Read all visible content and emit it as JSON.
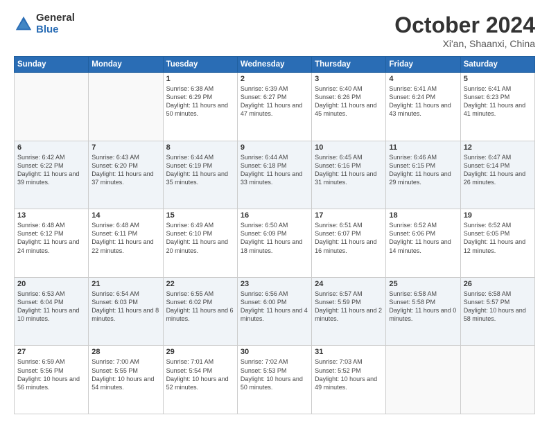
{
  "logo": {
    "general": "General",
    "blue": "Blue"
  },
  "title": {
    "month_year": "October 2024",
    "location": "Xi'an, Shaanxi, China"
  },
  "headers": [
    "Sunday",
    "Monday",
    "Tuesday",
    "Wednesday",
    "Thursday",
    "Friday",
    "Saturday"
  ],
  "weeks": [
    [
      {
        "day": "",
        "sunrise": "",
        "sunset": "",
        "daylight": ""
      },
      {
        "day": "",
        "sunrise": "",
        "sunset": "",
        "daylight": ""
      },
      {
        "day": "1",
        "sunrise": "Sunrise: 6:38 AM",
        "sunset": "Sunset: 6:29 PM",
        "daylight": "Daylight: 11 hours and 50 minutes."
      },
      {
        "day": "2",
        "sunrise": "Sunrise: 6:39 AM",
        "sunset": "Sunset: 6:27 PM",
        "daylight": "Daylight: 11 hours and 47 minutes."
      },
      {
        "day": "3",
        "sunrise": "Sunrise: 6:40 AM",
        "sunset": "Sunset: 6:26 PM",
        "daylight": "Daylight: 11 hours and 45 minutes."
      },
      {
        "day": "4",
        "sunrise": "Sunrise: 6:41 AM",
        "sunset": "Sunset: 6:24 PM",
        "daylight": "Daylight: 11 hours and 43 minutes."
      },
      {
        "day": "5",
        "sunrise": "Sunrise: 6:41 AM",
        "sunset": "Sunset: 6:23 PM",
        "daylight": "Daylight: 11 hours and 41 minutes."
      }
    ],
    [
      {
        "day": "6",
        "sunrise": "Sunrise: 6:42 AM",
        "sunset": "Sunset: 6:22 PM",
        "daylight": "Daylight: 11 hours and 39 minutes."
      },
      {
        "day": "7",
        "sunrise": "Sunrise: 6:43 AM",
        "sunset": "Sunset: 6:20 PM",
        "daylight": "Daylight: 11 hours and 37 minutes."
      },
      {
        "day": "8",
        "sunrise": "Sunrise: 6:44 AM",
        "sunset": "Sunset: 6:19 PM",
        "daylight": "Daylight: 11 hours and 35 minutes."
      },
      {
        "day": "9",
        "sunrise": "Sunrise: 6:44 AM",
        "sunset": "Sunset: 6:18 PM",
        "daylight": "Daylight: 11 hours and 33 minutes."
      },
      {
        "day": "10",
        "sunrise": "Sunrise: 6:45 AM",
        "sunset": "Sunset: 6:16 PM",
        "daylight": "Daylight: 11 hours and 31 minutes."
      },
      {
        "day": "11",
        "sunrise": "Sunrise: 6:46 AM",
        "sunset": "Sunset: 6:15 PM",
        "daylight": "Daylight: 11 hours and 29 minutes."
      },
      {
        "day": "12",
        "sunrise": "Sunrise: 6:47 AM",
        "sunset": "Sunset: 6:14 PM",
        "daylight": "Daylight: 11 hours and 26 minutes."
      }
    ],
    [
      {
        "day": "13",
        "sunrise": "Sunrise: 6:48 AM",
        "sunset": "Sunset: 6:12 PM",
        "daylight": "Daylight: 11 hours and 24 minutes."
      },
      {
        "day": "14",
        "sunrise": "Sunrise: 6:48 AM",
        "sunset": "Sunset: 6:11 PM",
        "daylight": "Daylight: 11 hours and 22 minutes."
      },
      {
        "day": "15",
        "sunrise": "Sunrise: 6:49 AM",
        "sunset": "Sunset: 6:10 PM",
        "daylight": "Daylight: 11 hours and 20 minutes."
      },
      {
        "day": "16",
        "sunrise": "Sunrise: 6:50 AM",
        "sunset": "Sunset: 6:09 PM",
        "daylight": "Daylight: 11 hours and 18 minutes."
      },
      {
        "day": "17",
        "sunrise": "Sunrise: 6:51 AM",
        "sunset": "Sunset: 6:07 PM",
        "daylight": "Daylight: 11 hours and 16 minutes."
      },
      {
        "day": "18",
        "sunrise": "Sunrise: 6:52 AM",
        "sunset": "Sunset: 6:06 PM",
        "daylight": "Daylight: 11 hours and 14 minutes."
      },
      {
        "day": "19",
        "sunrise": "Sunrise: 6:52 AM",
        "sunset": "Sunset: 6:05 PM",
        "daylight": "Daylight: 11 hours and 12 minutes."
      }
    ],
    [
      {
        "day": "20",
        "sunrise": "Sunrise: 6:53 AM",
        "sunset": "Sunset: 6:04 PM",
        "daylight": "Daylight: 11 hours and 10 minutes."
      },
      {
        "day": "21",
        "sunrise": "Sunrise: 6:54 AM",
        "sunset": "Sunset: 6:03 PM",
        "daylight": "Daylight: 11 hours and 8 minutes."
      },
      {
        "day": "22",
        "sunrise": "Sunrise: 6:55 AM",
        "sunset": "Sunset: 6:02 PM",
        "daylight": "Daylight: 11 hours and 6 minutes."
      },
      {
        "day": "23",
        "sunrise": "Sunrise: 6:56 AM",
        "sunset": "Sunset: 6:00 PM",
        "daylight": "Daylight: 11 hours and 4 minutes."
      },
      {
        "day": "24",
        "sunrise": "Sunrise: 6:57 AM",
        "sunset": "Sunset: 5:59 PM",
        "daylight": "Daylight: 11 hours and 2 minutes."
      },
      {
        "day": "25",
        "sunrise": "Sunrise: 6:58 AM",
        "sunset": "Sunset: 5:58 PM",
        "daylight": "Daylight: 11 hours and 0 minutes."
      },
      {
        "day": "26",
        "sunrise": "Sunrise: 6:58 AM",
        "sunset": "Sunset: 5:57 PM",
        "daylight": "Daylight: 10 hours and 58 minutes."
      }
    ],
    [
      {
        "day": "27",
        "sunrise": "Sunrise: 6:59 AM",
        "sunset": "Sunset: 5:56 PM",
        "daylight": "Daylight: 10 hours and 56 minutes."
      },
      {
        "day": "28",
        "sunrise": "Sunrise: 7:00 AM",
        "sunset": "Sunset: 5:55 PM",
        "daylight": "Daylight: 10 hours and 54 minutes."
      },
      {
        "day": "29",
        "sunrise": "Sunrise: 7:01 AM",
        "sunset": "Sunset: 5:54 PM",
        "daylight": "Daylight: 10 hours and 52 minutes."
      },
      {
        "day": "30",
        "sunrise": "Sunrise: 7:02 AM",
        "sunset": "Sunset: 5:53 PM",
        "daylight": "Daylight: 10 hours and 50 minutes."
      },
      {
        "day": "31",
        "sunrise": "Sunrise: 7:03 AM",
        "sunset": "Sunset: 5:52 PM",
        "daylight": "Daylight: 10 hours and 49 minutes."
      },
      {
        "day": "",
        "sunrise": "",
        "sunset": "",
        "daylight": ""
      },
      {
        "day": "",
        "sunrise": "",
        "sunset": "",
        "daylight": ""
      }
    ]
  ]
}
